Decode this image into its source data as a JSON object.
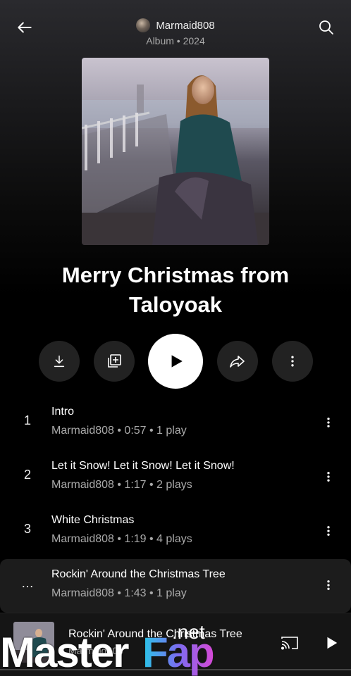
{
  "header": {
    "artist": "Marmaid808",
    "album_meta": "Album • 2024"
  },
  "album": {
    "title": "Merry Christmas from Taloyoak"
  },
  "actions": {
    "download_icon": "download-icon",
    "save_icon": "add-to-library-icon",
    "play_icon": "play-icon",
    "share_icon": "share-icon",
    "more_icon": "more-vert-icon"
  },
  "tracks": [
    {
      "num": "1",
      "title": "Intro",
      "sub": "Marmaid808 • 0:57 • 1 play"
    },
    {
      "num": "2",
      "title": "Let it Snow! Let it Snow! Let it Snow!",
      "sub": "Marmaid808 • 1:17 • 2 plays"
    },
    {
      "num": "3",
      "title": "White Christmas",
      "sub": "Marmaid808 • 1:19 • 4 plays"
    },
    {
      "num": "…",
      "title": "Rockin' Around the Christmas Tree",
      "sub": "Marmaid808 • 1:43 • 1 play"
    }
  ],
  "miniplayer": {
    "title": "Rockin' Around the Christmas Tree",
    "artist": "Marmaid808",
    "progress": 0.0
  },
  "watermark": {
    "master": "Master",
    "fap": "Fap",
    "net": ".net"
  },
  "colors": {
    "background": "#000000",
    "button_bg": "#222222",
    "muted_text": "#aaaaaa"
  }
}
